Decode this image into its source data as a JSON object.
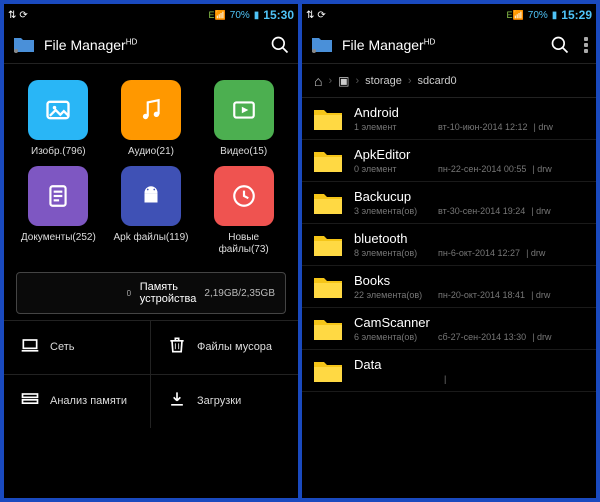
{
  "status": {
    "signal_text": "E",
    "battery": "70%",
    "left_clock": "15:30",
    "right_clock": "15:29"
  },
  "app": {
    "title": "File Manager",
    "hd": "HD"
  },
  "categories": [
    {
      "label": "Изобр.(796)",
      "color": "#29b6f6",
      "icon": "image"
    },
    {
      "label": "Аудио(21)",
      "color": "#ff9800",
      "icon": "audio"
    },
    {
      "label": "Видео(15)",
      "color": "#4caf50",
      "icon": "video"
    },
    {
      "label": "Документы(252)",
      "color": "#7e57c2",
      "icon": "doc"
    },
    {
      "label": "Apk файлы(119)",
      "color": "#3f51b5",
      "icon": "apk"
    },
    {
      "label": "Новые файлы(73)",
      "color": "#ef5350",
      "icon": "recent"
    }
  ],
  "storage": {
    "label": "Память устройства",
    "value": "2,19GB/2,35GB"
  },
  "bottom": [
    {
      "label": "Сеть",
      "icon": "net"
    },
    {
      "label": "Файлы мусора",
      "icon": "trash"
    },
    {
      "label": "Анализ памяти",
      "icon": "analyze"
    },
    {
      "label": "Загрузки",
      "icon": "download"
    }
  ],
  "breadcrumb": [
    "storage",
    "sdcard0"
  ],
  "files": [
    {
      "name": "Android",
      "items": "1 элемент",
      "date": "вт-10-июн-2014 12:12",
      "perm": "drw"
    },
    {
      "name": "ApkEditor",
      "items": "0 элемент",
      "date": "пн-22-сен-2014 00:55",
      "perm": "drw"
    },
    {
      "name": "Backucup",
      "items": "3 элемента(ов)",
      "date": "вт-30-сен-2014 19:24",
      "perm": "drw"
    },
    {
      "name": "bluetooth",
      "items": "8 элемента(ов)",
      "date": "пн-6-окт-2014 12:27",
      "perm": "drw"
    },
    {
      "name": "Books",
      "items": "22 элемента(ов)",
      "date": "пн-20-окт-2014 18:41",
      "perm": "drw"
    },
    {
      "name": "CamScanner",
      "items": "6 элемента(ов)",
      "date": "сб-27-сен-2014 13:30",
      "perm": "drw"
    },
    {
      "name": "Data",
      "items": "",
      "date": "",
      "perm": ""
    }
  ]
}
